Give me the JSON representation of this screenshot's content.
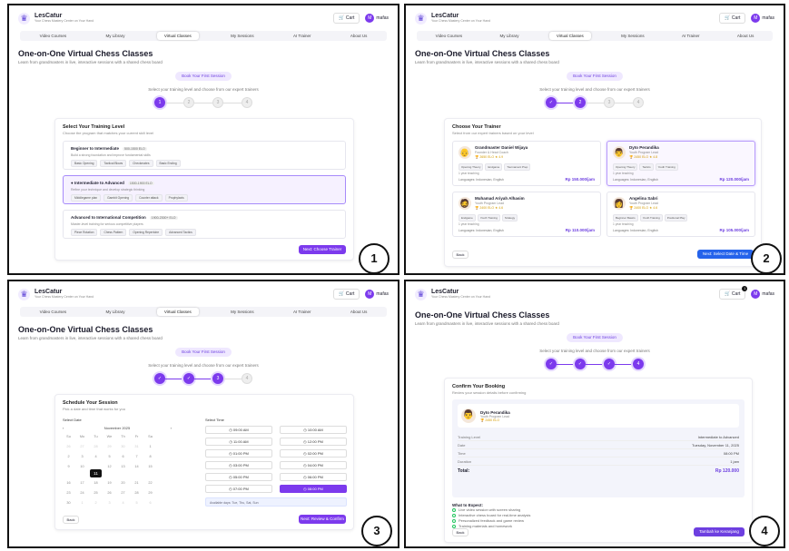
{
  "header": {
    "brand": "LesCatur",
    "tagline": "Your Chess Mastery Center on Your Hand",
    "cart_label": "Cart",
    "cart_badge": "1",
    "user_initial": "M",
    "user_name": "mafas"
  },
  "nav": [
    "Video Courses",
    "My Library",
    "Virtual Classes",
    "My Sessions",
    "AI Trainer",
    "About Us"
  ],
  "page": {
    "title": "One-on-One Virtual Chess Classes",
    "subtitle": "Learn from grandmasters in live, interactive sessions with a shared chess board",
    "book_label": "Book Your First Session",
    "select_text": "Select your training level and choose from our expert trainers"
  },
  "step_numbers": [
    "1",
    "2",
    "3",
    "4"
  ],
  "panel1": {
    "label": "1",
    "heading": "Select Your Training Level",
    "sub": "Choose the program that matches your current skill level",
    "levels": [
      {
        "name": "Beginner to Intermediate",
        "rating": "500-1500 ELO",
        "desc": "Build a strong foundation and improve fundamental skills",
        "tags": [
          "Basic Opening",
          "Tactical Blows",
          "Checkmates",
          "Basic Ending"
        ]
      },
      {
        "name": "Intermediate to Advanced",
        "rating": "1500-1900 ELO",
        "desc": "Refine your technique and develop strategic thinking",
        "tags": [
          "Middlegame plan",
          "Gambit Opening",
          "Counter attack",
          "Prophylaxis"
        ]
      },
      {
        "name": "Advanced to International Competition",
        "rating": "1900-2300+ ELO",
        "desc": "Master-level training for serious competitive players",
        "tags": [
          "Piece Rotation",
          "Chess Pattern",
          "Opening Repertoire",
          "Advanced Tactics"
        ]
      }
    ],
    "next_label": "Next: Choose Trainer"
  },
  "panel2": {
    "label": "2",
    "heading": "Choose Your Trainer",
    "sub": "Select from our expert trainers based on your level",
    "trainers": [
      {
        "name": "Grandmaster Daniel Wijaya",
        "title": "Founder & Head Coach",
        "rating": "2650 ELO",
        "score": "4.9",
        "tags": [
          "Opening Theory",
          "Endgame",
          "Tournament Prep"
        ],
        "exp": "1 year teaching",
        "lang": "Languages: Indonesian, English",
        "price": "Rp 150.000/jam"
      },
      {
        "name": "Dyto Perandika",
        "title": "Youth Program Lead",
        "rating": "2450 ELO",
        "score": "4.8",
        "tags": [
          "Opening Theory",
          "Tactics",
          "Youth Training"
        ],
        "exp": "1 year teaching",
        "lang": "Languages: Indonesian, English",
        "price": "Rp 120.000/jam"
      },
      {
        "name": "Muhamad Ariyah Alhasim",
        "title": "Youth Program Lead",
        "rating": "2400 ELO",
        "score": "4.6",
        "tags": [
          "Endgame",
          "Youth Training",
          "Strategy"
        ],
        "exp": "1 year teaching",
        "lang": "Languages: Indonesian, English",
        "price": "Rp 110.000/jam"
      },
      {
        "name": "Angelina Sabri",
        "title": "Youth Program Lead",
        "rating": "2400 ELO",
        "score": "4.6",
        "tags": [
          "Beginner Basics",
          "Youth Training",
          "Positional Play"
        ],
        "exp": "1 year teaching",
        "lang": "Languages: Indonesian, English",
        "price": "Rp 105.000/jam"
      }
    ],
    "back_label": "Back",
    "next_label": "Next: Select Date & Time"
  },
  "panel3": {
    "label": "3",
    "heading": "Schedule Your Session",
    "sub": "Pick a date and time that works for you",
    "date_label": "Select Date",
    "time_label": "Select Time",
    "month": "November 2025",
    "weekdays": [
      "Su",
      "Mo",
      "Tu",
      "We",
      "Th",
      "Fr",
      "Sa"
    ],
    "days": [
      "26",
      "27",
      "28",
      "29",
      "30",
      "31",
      "1",
      "2",
      "3",
      "4",
      "5",
      "6",
      "7",
      "8",
      "9",
      "10",
      "11",
      "12",
      "13",
      "14",
      "15",
      "16",
      "17",
      "18",
      "19",
      "20",
      "21",
      "22",
      "23",
      "24",
      "25",
      "26",
      "27",
      "28",
      "29",
      "30",
      "1",
      "2",
      "3",
      "4",
      "5",
      "6"
    ],
    "times": [
      "09:00 AM",
      "10:00 AM",
      "11:00 AM",
      "12:00 PM",
      "01:00 PM",
      "02:00 PM",
      "03:00 PM",
      "04:00 PM",
      "05:00 PM",
      "06:00 PM",
      "07:00 PM",
      "08:00 PM"
    ],
    "available": "Available days: Tue, Thu, Sat, Sun",
    "back_label": "Back",
    "next_label": "Next: Review & Confirm"
  },
  "panel4": {
    "label": "4",
    "heading": "Confirm Your Booking",
    "sub": "Review your session details before confirming",
    "trainer_name": "Dyto Perandika",
    "trainer_title": "Youth Program Lead",
    "trainer_rating": "2450 ELO",
    "rows": [
      {
        "k": "Training Level",
        "v": "Intermediate to Advanced"
      },
      {
        "k": "Date",
        "v": "Tuesday, November 11, 2025"
      },
      {
        "k": "Time",
        "v": "08:00 PM"
      },
      {
        "k": "Duration",
        "v": "1 jam"
      }
    ],
    "total_label": "Total:",
    "total_value": "Rp 120.000",
    "expect_heading": "What to Expect:",
    "expect": [
      "Live video session with screen sharing",
      "Interactive chess board for real-time analysis",
      "Personalized feedback and game review",
      "Training materials and homework"
    ],
    "back_label": "Back",
    "next_label": "Tambah ke Keranjang"
  }
}
